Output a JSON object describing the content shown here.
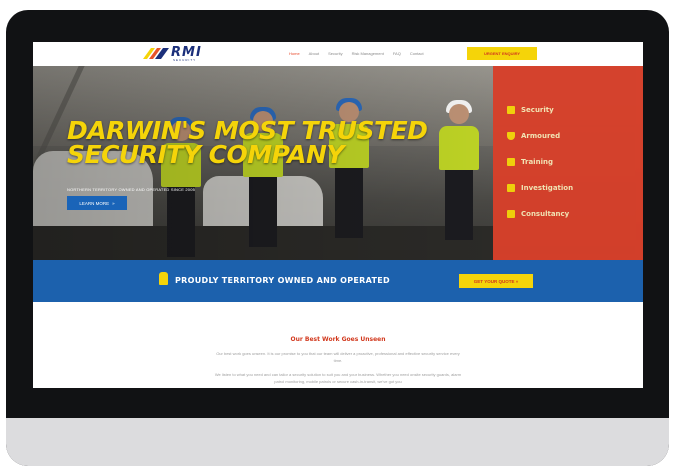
{
  "brand": {
    "logo_text": "RMI",
    "logo_sub": "SECURITY"
  },
  "nav": {
    "items": [
      "Home",
      "About",
      "Security",
      "Risk Management",
      "FAQ",
      "Contact"
    ],
    "urgent_label": "URGENT ENQUIRY"
  },
  "hero": {
    "title": "DARWIN'S MOST TRUSTED SECURITY COMPANY",
    "subtitle": "NORTHERN TERRITORY OWNED AND OPERATED SINCE 2005",
    "cta_label": "LEARN MORE",
    "cta_icon": "chevron-right-icon"
  },
  "services": [
    {
      "label": "Security",
      "icon": "security-guard-icon"
    },
    {
      "label": "Armoured",
      "icon": "shield-icon"
    },
    {
      "label": "Training",
      "icon": "training-icon"
    },
    {
      "label": "Investigation",
      "icon": "investigation-icon"
    },
    {
      "label": "Consultancy",
      "icon": "consultancy-icon"
    }
  ],
  "band": {
    "text": "PROUDLY TERRITORY OWNED AND OPERATED",
    "quote_label": "GET YOUR QUOTE",
    "icon": "nt-map-icon"
  },
  "content": {
    "heading": "Our Best Work Goes Unseen",
    "paragraph1": "Our best work goes unseen. It is our promise to you that our team will deliver a proactive, professional and effective security service every time.",
    "paragraph2": "We listen to what you need and can tailor a security solution to suit you and your business. Whether you need onsite security guards, alarm patrol monitoring, mobile patrols or secure cash-in-transit, we've got you"
  },
  "colors": {
    "accent_yellow": "#f5d409",
    "brand_red": "#d8402a",
    "brand_blue": "#1c61ad",
    "device_frame": "#111214"
  }
}
